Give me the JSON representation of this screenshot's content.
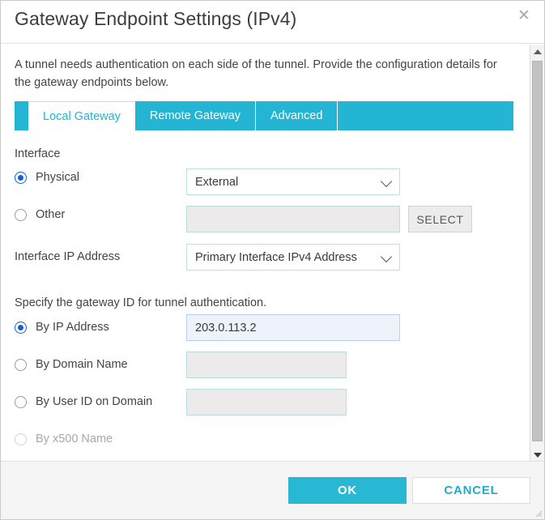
{
  "dialog": {
    "title": "Gateway Endpoint Settings (IPv4)",
    "close_icon": "close-icon",
    "intro": "A tunnel needs authentication on each side of the tunnel. Provide the configuration details for the gateway endpoints below."
  },
  "tabs": [
    {
      "label": "Local Gateway",
      "active": true
    },
    {
      "label": "Remote Gateway",
      "active": false
    },
    {
      "label": "Advanced",
      "active": false
    }
  ],
  "interface_section": {
    "label": "Interface",
    "options": [
      {
        "label": "Physical",
        "selected": true
      },
      {
        "label": "Other",
        "selected": false
      }
    ],
    "physical_select": {
      "value": "External",
      "chevron_icon": "chevron-down-icon"
    },
    "other_input": {
      "value": "",
      "placeholder": ""
    },
    "select_button": {
      "label": "SELECT"
    },
    "ip_address_label": "Interface IP Address",
    "ip_address_select": {
      "value": "Primary Interface IPv4 Address",
      "chevron_icon": "chevron-down-icon"
    }
  },
  "gateway_id_section": {
    "instruction": "Specify the gateway ID for tunnel authentication.",
    "options": [
      {
        "label": "By IP Address",
        "selected": true,
        "disabled": false,
        "value": "203.0.113.2",
        "has_input": true
      },
      {
        "label": "By Domain Name",
        "selected": false,
        "disabled": false,
        "value": "",
        "has_input": true
      },
      {
        "label": "By User ID on Domain",
        "selected": false,
        "disabled": false,
        "value": "",
        "has_input": true
      },
      {
        "label": "By x500 Name",
        "selected": false,
        "disabled": true,
        "value": "",
        "has_input": false
      }
    ]
  },
  "scrollbar": {
    "up_icon": "scroll-up-arrow-icon",
    "down_icon": "scroll-down-arrow-icon"
  },
  "footer": {
    "ok_label": "OK",
    "cancel_label": "CANCEL"
  },
  "colors": {
    "accent_teal": "#29b8d4",
    "tab_teal": "#23b5d3",
    "radio_blue": "#1560d1",
    "cancel_text": "#27a9c6"
  }
}
